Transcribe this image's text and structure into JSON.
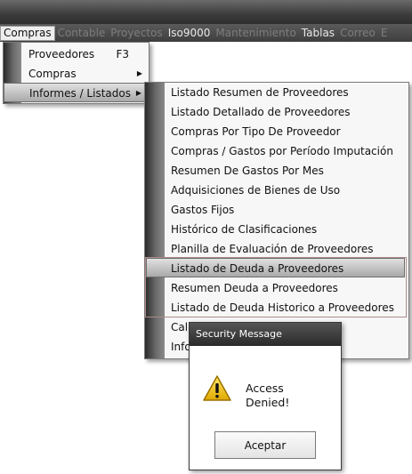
{
  "menubar": {
    "items": [
      {
        "label": "Compras",
        "state": "active"
      },
      {
        "label": "Contable",
        "state": "disabled"
      },
      {
        "label": "Proyectos",
        "state": "disabled"
      },
      {
        "label": "Iso9000",
        "state": "enabled"
      },
      {
        "label": "Mantenimiento",
        "state": "disabled"
      },
      {
        "label": "Tablas",
        "state": "enabled"
      },
      {
        "label": "Correo",
        "state": "disabled"
      },
      {
        "label": "E",
        "state": "disabled"
      }
    ]
  },
  "compras_menu": {
    "items": [
      {
        "label": "Proveedores",
        "shortcut": "F3"
      },
      {
        "label": "Compras"
      },
      {
        "label": "Informes / Listados"
      }
    ]
  },
  "informes_menu": {
    "items": [
      {
        "label": "Listado Resumen de Proveedores"
      },
      {
        "label": "Listado Detallado de Proveedores"
      },
      {
        "label": "Compras Por Tipo De Proveedor"
      },
      {
        "label": "Compras / Gastos por Período Imputación"
      },
      {
        "label": "Resumen De Gastos Por Mes"
      },
      {
        "label": "Adquisiciones de Bienes de Uso"
      },
      {
        "label": "Gastos Fijos"
      },
      {
        "label": "Histórico de Clasificaciones"
      },
      {
        "label": "Planilla de Evaluación de Proveedores"
      },
      {
        "label": "Listado de Deuda a Proveedores"
      },
      {
        "label": "Resumen Deuda a Proveedores"
      },
      {
        "label": "Listado de Deuda Historico a Proveedores"
      },
      {
        "label": "Cal"
      },
      {
        "label": "Info"
      }
    ]
  },
  "dialog": {
    "title": "Security Message",
    "message_line1": "Access",
    "message_line2": "Denied!",
    "button_label": "Aceptar",
    "icon": "warning-icon"
  }
}
